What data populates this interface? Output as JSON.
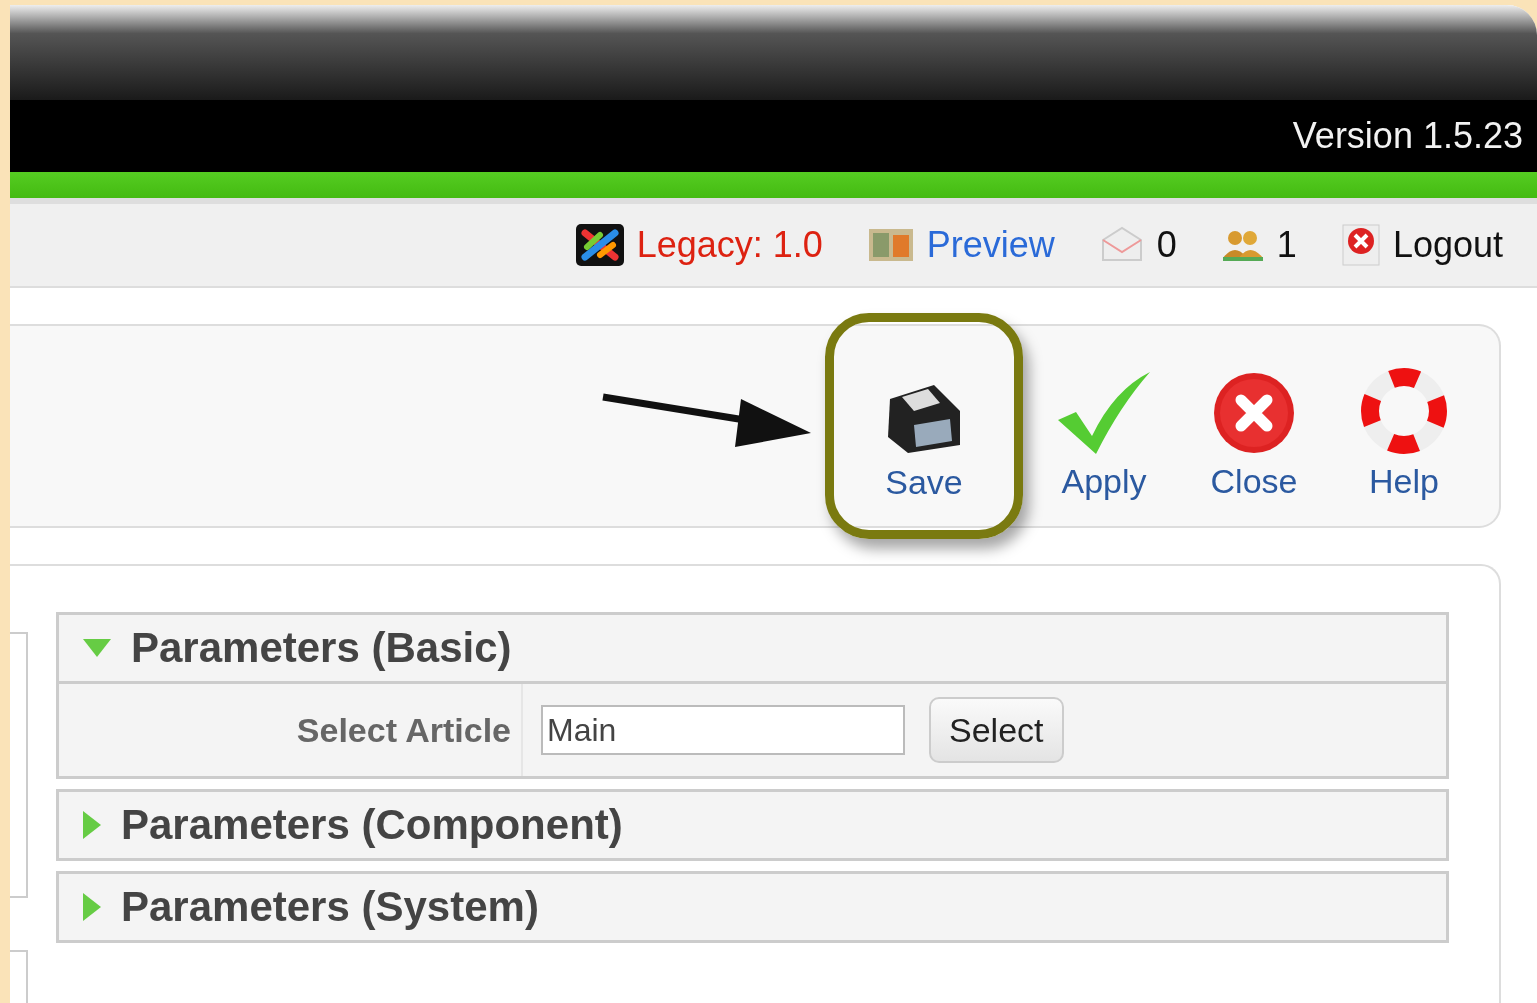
{
  "header": {
    "version": "Version 1.5.23"
  },
  "status_bar": [
    {
      "kind": "legacy",
      "label": "Legacy: 1.0"
    },
    {
      "kind": "preview",
      "label": "Preview"
    },
    {
      "kind": "messages",
      "label": "0"
    },
    {
      "kind": "users",
      "label": "1"
    },
    {
      "kind": "logout",
      "label": "Logout"
    }
  ],
  "toolbar": {
    "buttons": [
      {
        "kind": "save",
        "label": "Save",
        "highlighted": true
      },
      {
        "kind": "apply",
        "label": "Apply",
        "highlighted": false
      },
      {
        "kind": "close",
        "label": "Close",
        "highlighted": false
      },
      {
        "kind": "help",
        "label": "Help",
        "highlighted": false
      }
    ]
  },
  "panels": [
    {
      "title": "Parameters (Basic)",
      "expanded": true,
      "fields": [
        {
          "label": "Select Article",
          "value": "Main",
          "button": "Select"
        }
      ]
    },
    {
      "title": "Parameters (Component)",
      "expanded": false
    },
    {
      "title": "Parameters (System)",
      "expanded": false
    }
  ]
}
